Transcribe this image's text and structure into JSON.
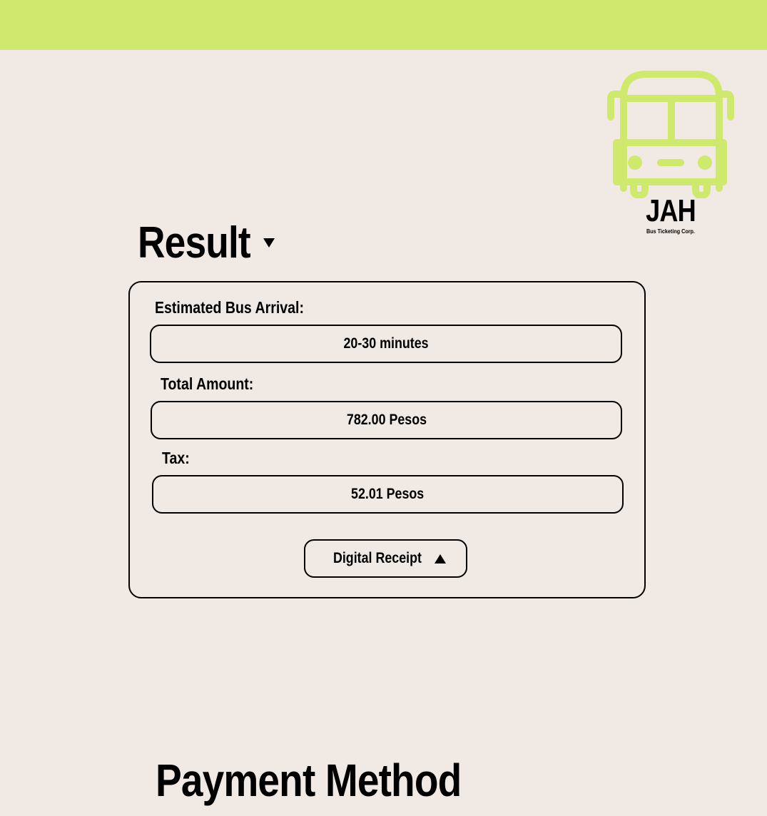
{
  "header": {
    "bar_color": "#cfe96d"
  },
  "logo": {
    "icon": "bus-icon",
    "icon_color": "#cfe96d",
    "name": "JAH",
    "tagline": "Bus Ticketing Corp."
  },
  "result": {
    "title": "Result",
    "toggle_icon": "caret-down-icon",
    "fields": [
      {
        "label": "Estimated Bus Arrival:",
        "value": "20-30 minutes"
      },
      {
        "label": "Total Amount:",
        "value": "782.00 Pesos"
      },
      {
        "label": "Tax:",
        "value": "52.01 Pesos"
      }
    ],
    "receipt_button": {
      "label": "Digital Receipt",
      "icon": "caret-up-icon"
    }
  },
  "payment": {
    "title": "Payment Method"
  },
  "colors": {
    "background": "#f1e9e3",
    "accent": "#cfe96d",
    "ink": "#000000"
  }
}
